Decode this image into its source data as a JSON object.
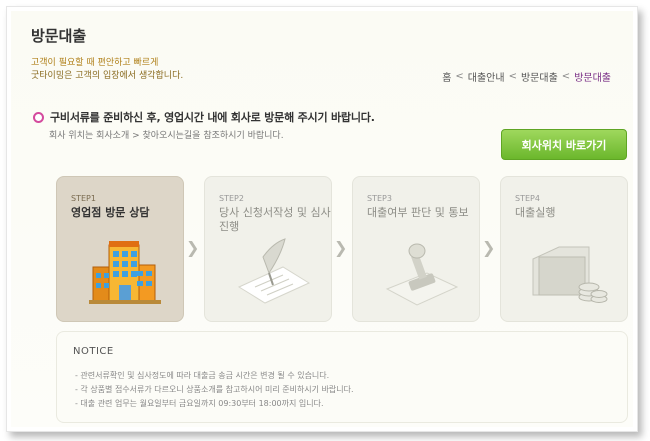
{
  "header": {
    "title": "방문대출",
    "subtitle1": "고객이 필요할 때 편안하고 빠르게",
    "subtitle2": "굿타이밍은 고객의 입장에서 생각합니다."
  },
  "breadcrumb": {
    "items": [
      "홈",
      "대출안내",
      "방문대출",
      "방문대출"
    ],
    "separator": "<"
  },
  "intro": {
    "headline": "구비서류를 준비하신 후, 영업시간 내에 회사로 방문해 주시기 바랍니다.",
    "note": "회사 위치는 회사소개 > 찾아오시는길을 참조하시기 바랍니다.",
    "button_label": "회사위치 바로가기"
  },
  "steps": [
    {
      "num": "STEP1",
      "label": "영업점 방문 상담",
      "icon": "building-icon",
      "active": true
    },
    {
      "num": "STEP2",
      "label": "당사 신청서작성 및 심사진행",
      "icon": "pen-paper-icon",
      "active": false
    },
    {
      "num": "STEP3",
      "label": "대출여부 판단 및 통보",
      "icon": "stamp-icon",
      "active": false
    },
    {
      "num": "STEP4",
      "label": "대출실행",
      "icon": "money-folder-icon",
      "active": false
    }
  ],
  "notice": {
    "title": "NOTICE",
    "items": [
      "- 관련서류확인 및 심사정도에 따라 대출금 송금 시간은 변경 될 수 있습니다.",
      "- 각 상품별 접수서류가 다르오니 상품소개를 참고하시어 미리 준비하시기 바랍니다.",
      "- 대출 관련 업무는 월요일부터 금요일까지 09:30부터 18:00까지 입니다."
    ]
  },
  "colors": {
    "accent_pink": "#d44a9d",
    "button_green": "#6bb72c",
    "current_crumb": "#7a2f86"
  }
}
